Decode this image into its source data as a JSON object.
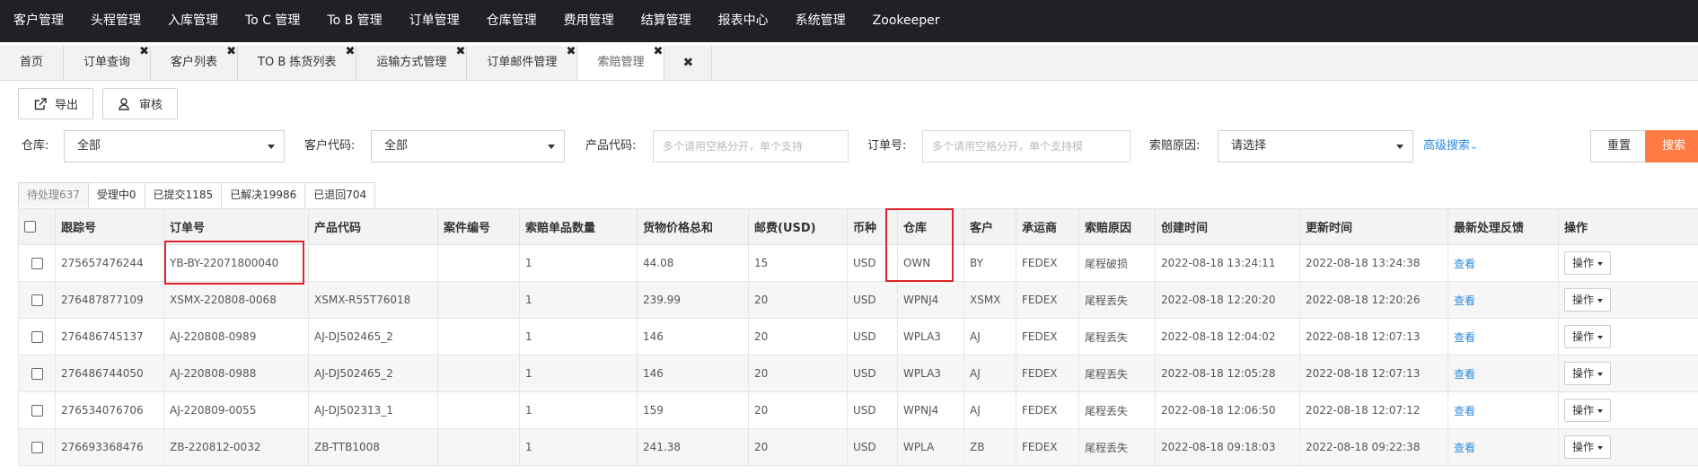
{
  "topnav": [
    "客户管理",
    "头程管理",
    "入库管理",
    "To C 管理",
    "To B 管理",
    "订单管理",
    "仓库管理",
    "费用管理",
    "结算管理",
    "报表中心",
    "系统管理",
    "Zookeeper"
  ],
  "tabs": [
    {
      "label": "首页",
      "closable": false,
      "active": false
    },
    {
      "label": "订单查询",
      "closable": true,
      "active": false
    },
    {
      "label": "客户列表",
      "closable": true,
      "active": false
    },
    {
      "label": "TO B 拣货列表",
      "closable": true,
      "active": false
    },
    {
      "label": "运输方式管理",
      "closable": true,
      "active": false
    },
    {
      "label": "订单邮件管理",
      "closable": true,
      "active": false
    },
    {
      "label": "索赔管理",
      "closable": true,
      "active": true
    }
  ],
  "tab_close_glyph": "✖",
  "toolbar": {
    "export_label": "导出",
    "review_label": "审核"
  },
  "filters": {
    "warehouse_label": "仓库:",
    "warehouse_value": "全部",
    "customer_label": "客户代码:",
    "customer_value": "全部",
    "product_label": "产品代码:",
    "product_placeholder": "多个请用空格分开，单个支持",
    "order_label": "订单号:",
    "order_placeholder": "多个请用空格分开，单个支持模",
    "reason_label": "索赔原因:",
    "reason_value": "请选择",
    "advanced_label": "高级搜索",
    "reset_label": "重置",
    "search_label": "搜索"
  },
  "status_tabs": [
    {
      "label": "待处理637",
      "active": true
    },
    {
      "label": "受理中0",
      "active": false
    },
    {
      "label": "已提交1185",
      "active": false
    },
    {
      "label": "已解决19986",
      "active": false
    },
    {
      "label": "已退回704",
      "active": false
    }
  ],
  "table": {
    "headers": [
      "跟踪号",
      "订单号",
      "产品代码",
      "案件编号",
      "索赔单品数量",
      "货物价格总和",
      "邮费(USD)",
      "币种",
      "仓库",
      "客户",
      "承运商",
      "索赔原因",
      "创建时间",
      "更新时间",
      "最新处理反馈",
      "操作"
    ],
    "view_label": "查看",
    "op_label": "操作",
    "rows": [
      [
        "275657476244",
        "YB-BY-22071800040",
        "",
        "",
        "1",
        "44.08",
        "15",
        "USD",
        "OWN",
        "BY",
        "FEDEX",
        "尾程破损",
        "2022-08-18 13:24:11",
        "2022-08-18 13:24:38"
      ],
      [
        "276487877109",
        "XSMX-220808-0068",
        "XSMX-R55T76018",
        "",
        "1",
        "239.99",
        "20",
        "USD",
        "WPNJ4",
        "XSMX",
        "FEDEX",
        "尾程丢失",
        "2022-08-18 12:20:20",
        "2022-08-18 12:20:26"
      ],
      [
        "276486745137",
        "AJ-220808-0989",
        "AJ-DJ502465_2",
        "",
        "1",
        "146",
        "20",
        "USD",
        "WPLA3",
        "AJ",
        "FEDEX",
        "尾程丢失",
        "2022-08-18 12:04:02",
        "2022-08-18 12:07:13"
      ],
      [
        "276486744050",
        "AJ-220808-0988",
        "AJ-DJ502465_2",
        "",
        "1",
        "146",
        "20",
        "USD",
        "WPLA3",
        "AJ",
        "FEDEX",
        "尾程丢失",
        "2022-08-18 12:05:28",
        "2022-08-18 12:07:13"
      ],
      [
        "276534076706",
        "AJ-220809-0055",
        "AJ-DJ502313_1",
        "",
        "1",
        "159",
        "20",
        "USD",
        "WPNJ4",
        "AJ",
        "FEDEX",
        "尾程丢失",
        "2022-08-18 12:06:50",
        "2022-08-18 12:07:12"
      ],
      [
        "276693368476",
        "ZB-220812-0032",
        "ZB-TTB1008",
        "",
        "1",
        "241.38",
        "20",
        "USD",
        "WPLA",
        "ZB",
        "FEDEX",
        "尾程丢失",
        "2022-08-18 09:18:03",
        "2022-08-18 09:22:38"
      ]
    ]
  },
  "colors": {
    "topnav_bg": "#1f2126",
    "accent_orange": "#ff7a45",
    "link_blue": "#2a8ce0",
    "highlight_red": "#e0242a"
  }
}
